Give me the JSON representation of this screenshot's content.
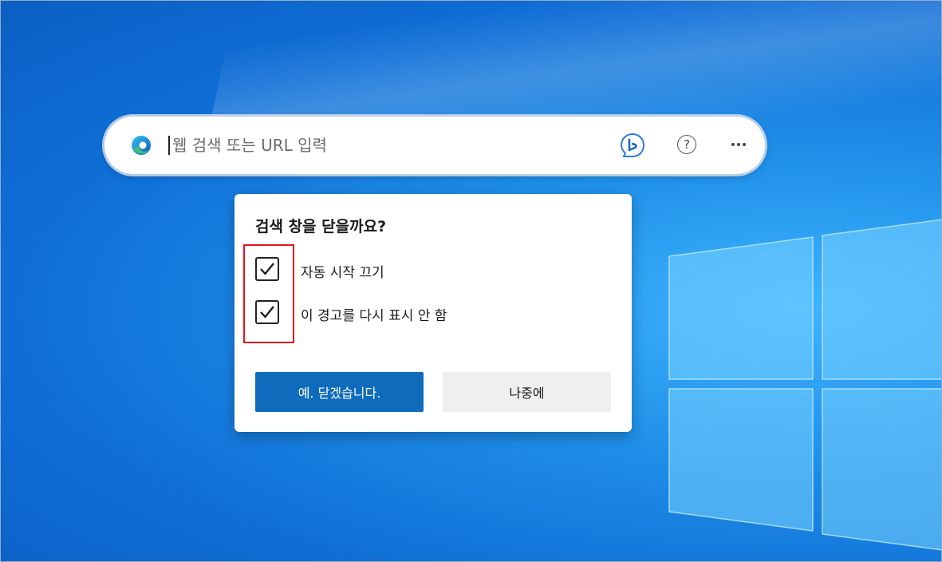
{
  "search": {
    "placeholder": "웹 검색 또는 URL 입력",
    "help_symbol": "?"
  },
  "icons": {
    "edge": "edge-browser-icon",
    "bing": "bing-chat-icon",
    "help": "help-icon",
    "more": "more-options-icon",
    "check": "checkmark-icon"
  },
  "dialog": {
    "title": "검색 창을 닫을까요?",
    "options": [
      {
        "label": "자동 시작 끄기",
        "checked": true
      },
      {
        "label": "이 경고를 다시 표시 안 함",
        "checked": true
      }
    ],
    "confirm_label": "예. 닫겠습니다.",
    "cancel_label": "나중에"
  },
  "colors": {
    "primary_button": "#0f6cbd",
    "highlight_box": "#e0141e",
    "desktop_blue": "#1f8fe8"
  }
}
